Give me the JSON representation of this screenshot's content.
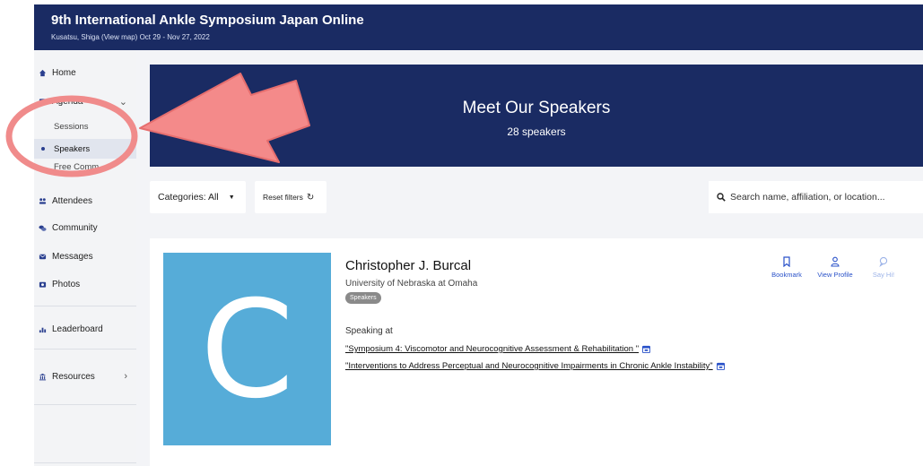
{
  "event": {
    "title": "9th International Ankle Symposium Japan Online",
    "subtitle": "Kusatsu, Shiga (View map)   Oct 29 - Nov 27, 2022"
  },
  "sidebar": {
    "home": "Home",
    "agenda": "Agenda",
    "sessions": "Sessions",
    "speakers": "Speakers",
    "free_comm": "Free Comm",
    "attendees": "Attendees",
    "community": "Community",
    "messages": "Messages",
    "photos": "Photos",
    "leaderboard": "Leaderboard",
    "resources": "Resources"
  },
  "hero": {
    "title": "Meet Our Speakers",
    "count": "28 speakers"
  },
  "filters": {
    "categories": "Categories: All",
    "reset": "Reset filters",
    "search_placeholder": "Search name, affiliation, or location..."
  },
  "speaker": {
    "initial": "C",
    "name": "Christopher J. Burcal",
    "affiliation": "University of Nebraska at Omaha",
    "badge": "Speakers",
    "speaking_at": "Speaking at",
    "sessions": [
      "\"Symposium 4: Viscomotor and Neurocognitive Assessment & Rehabilitation \"",
      "\"Interventions to Address Perceptual and Neurocognitive Impairments in Chronic Ankle Instability\""
    ],
    "actions": {
      "bookmark": "Bookmark",
      "view_profile": "View Profile",
      "say_hi": "Say Hi!"
    }
  },
  "colors": {
    "navy": "#1a2b63",
    "avatar": "#56acd8",
    "annotation": "#f08080",
    "link_blue": "#2a52c9"
  }
}
